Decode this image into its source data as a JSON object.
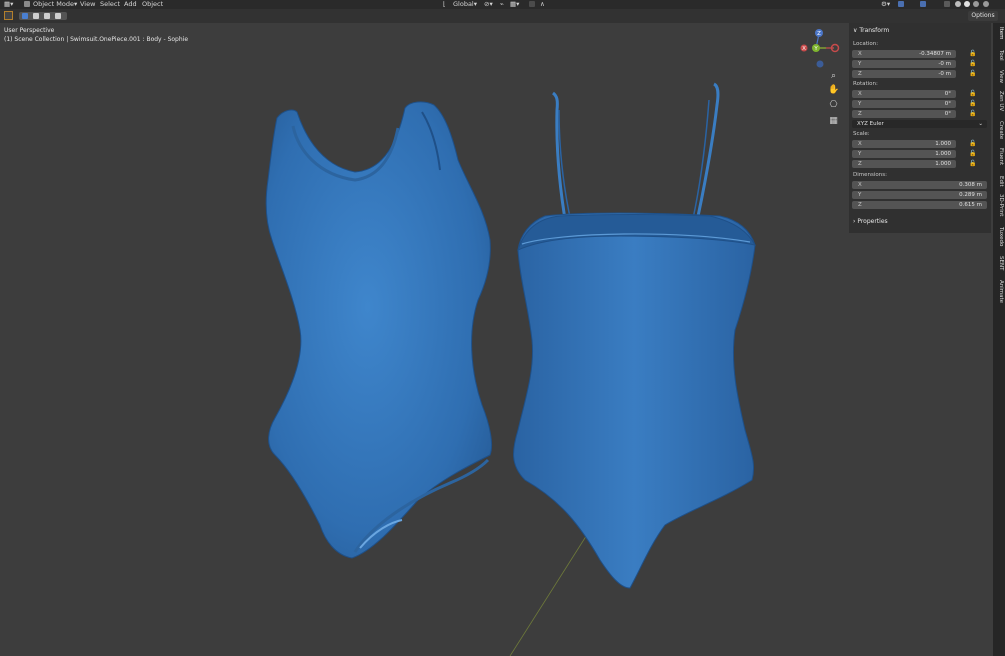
{
  "header": {
    "mode": "Object Mode",
    "menus": [
      "View",
      "Select",
      "Add",
      "Object"
    ],
    "orientation": "Global",
    "options_label": "Options"
  },
  "viewport": {
    "perspective": "User Perspective",
    "collection_line": "(1) Scene Collection | Swimsuit.OnePiece.001 : Body - Sophie",
    "object_color": "#3a7dc2",
    "background_color": "#3d3d3d"
  },
  "gizmo": {
    "x": "X",
    "y": "Y",
    "z": "Z"
  },
  "npanel": {
    "title": "Transform",
    "location_label": "Location:",
    "location": {
      "x": "-0.34807 m",
      "y": "-0 m",
      "z": "-0 m"
    },
    "rotation_label": "Rotation:",
    "rotation": {
      "x": "0°",
      "y": "0°",
      "z": "0°"
    },
    "rotation_mode": "XYZ Euler",
    "scale_label": "Scale:",
    "scale": {
      "x": "1.000",
      "y": "1.000",
      "z": "1.000"
    },
    "dimensions_label": "Dimensions:",
    "dimensions": {
      "x": "0.308 m",
      "y": "0.289 m",
      "z": "0.615 m"
    },
    "properties_label": "Properties"
  },
  "tabs": [
    "Item",
    "Tool",
    "View",
    "Zen UV",
    "Create",
    "Fluent",
    "Edit",
    "3D-Print",
    "Tuxedo",
    "SENT",
    "Animate"
  ]
}
